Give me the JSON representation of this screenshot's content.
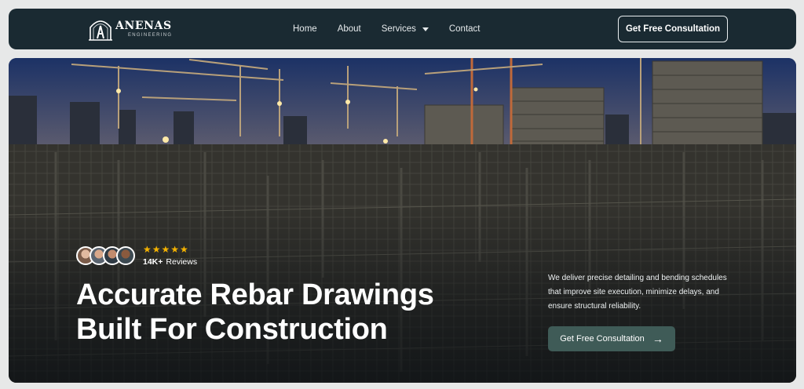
{
  "brand": {
    "name": "ANENAS",
    "tagline": "ENGINEERING"
  },
  "nav": {
    "items": [
      {
        "label": "Home"
      },
      {
        "label": "About"
      },
      {
        "label": "Services"
      },
      {
        "label": "Contact"
      }
    ],
    "cta": "Get Free Consultation"
  },
  "hero": {
    "rating_stars": "★★★★★",
    "review_count": "14K+",
    "review_label": "Reviews",
    "headline_line1": "Accurate Rebar Drawings",
    "headline_line2": "Built For Construction",
    "description": "We deliver precise detailing and bending schedules that improve site execution, minimize delays, and ensure structural reliability.",
    "cta": "Get Free Consultation",
    "cta_arrow": "→"
  },
  "colors": {
    "navbar_bg": "#1a2a32",
    "page_bg": "#e7e8e8",
    "star": "#f5b301",
    "hero_button": "#3f5b57"
  }
}
